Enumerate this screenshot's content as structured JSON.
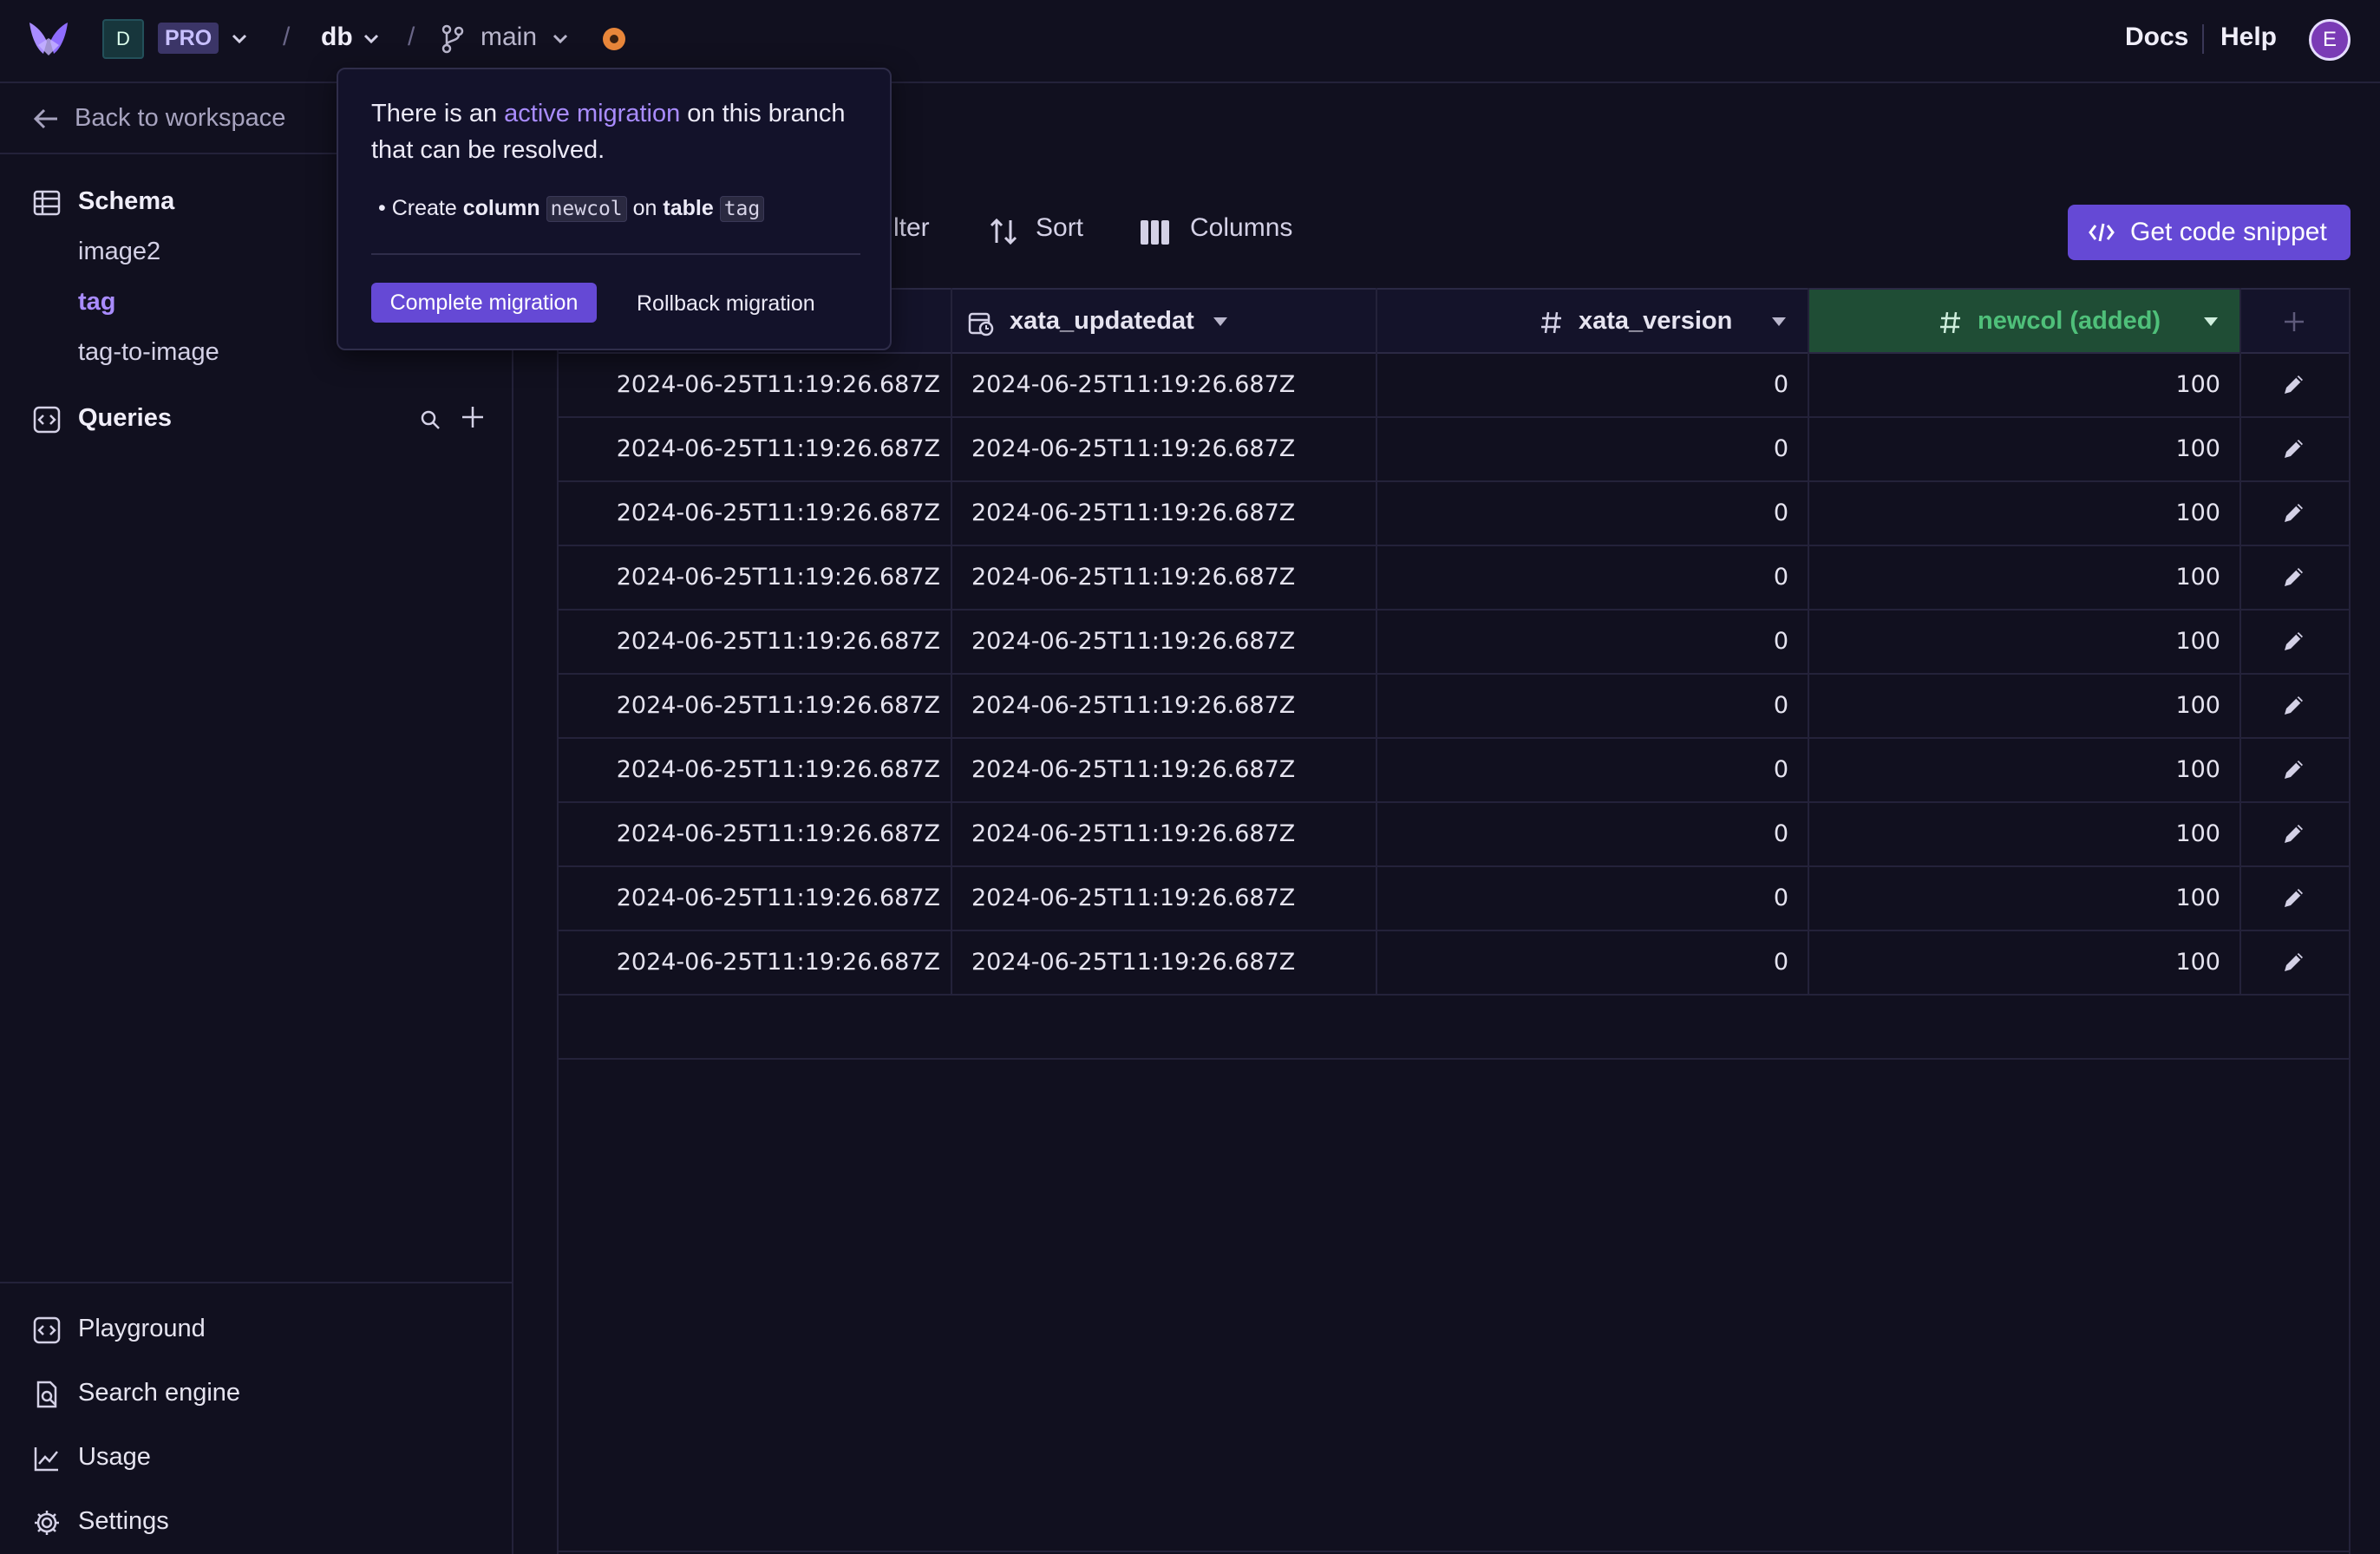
{
  "topbar": {
    "workspace_initial": "D",
    "plan_badge": "PRO",
    "separator": "/",
    "database": "db",
    "branch": "main",
    "docs": "Docs",
    "help": "Help",
    "user_initial": "E"
  },
  "sidebar": {
    "back": "Back to workspace",
    "schema_title": "Schema",
    "tables": [
      "image2",
      "tag",
      "tag-to-image"
    ],
    "active_table": "tag",
    "queries_title": "Queries",
    "bottom_nav": [
      "Playground",
      "Search engine",
      "Usage",
      "Settings"
    ]
  },
  "toolbar": {
    "filter": "lter",
    "sort": "Sort",
    "columns": "Columns",
    "snippet": "Get code snippet"
  },
  "table": {
    "columns": [
      {
        "name": "",
        "type": "datetime"
      },
      {
        "name": "xata_updatedat",
        "type": "datetime"
      },
      {
        "name": "xata_version",
        "type": "number"
      },
      {
        "name": "newcol (added)",
        "type": "number",
        "highlight": true
      }
    ],
    "rows": [
      [
        "2024-06-25T11:19:26.687Z",
        "2024-06-25T11:19:26.687Z",
        "0",
        "100"
      ],
      [
        "2024-06-25T11:19:26.687Z",
        "2024-06-25T11:19:26.687Z",
        "0",
        "100"
      ],
      [
        "2024-06-25T11:19:26.687Z",
        "2024-06-25T11:19:26.687Z",
        "0",
        "100"
      ],
      [
        "2024-06-25T11:19:26.687Z",
        "2024-06-25T11:19:26.687Z",
        "0",
        "100"
      ],
      [
        "2024-06-25T11:19:26.687Z",
        "2024-06-25T11:19:26.687Z",
        "0",
        "100"
      ],
      [
        "2024-06-25T11:19:26.687Z",
        "2024-06-25T11:19:26.687Z",
        "0",
        "100"
      ],
      [
        "2024-06-25T11:19:26.687Z",
        "2024-06-25T11:19:26.687Z",
        "0",
        "100"
      ],
      [
        "2024-06-25T11:19:26.687Z",
        "2024-06-25T11:19:26.687Z",
        "0",
        "100"
      ],
      [
        "2024-06-25T11:19:26.687Z",
        "2024-06-25T11:19:26.687Z",
        "0",
        "100"
      ],
      [
        "2024-06-25T11:19:26.687Z",
        "2024-06-25T11:19:26.687Z",
        "0",
        "100"
      ]
    ]
  },
  "popover": {
    "text_before": "There is an ",
    "link": "active migration",
    "text_after": " on this branch that can be resolved.",
    "bullet_create": "Create",
    "bullet_column_word": "column",
    "bullet_column_name": "newcol",
    "bullet_on": "on",
    "bullet_table_word": "table",
    "bullet_table_name": "tag",
    "complete": "Complete migration",
    "rollback": "Rollback migration"
  },
  "colors": {
    "accent": "#6549d5",
    "active_link": "#a98cff",
    "added_column_bg": "#1f4d35",
    "added_column_text": "#4fc07a",
    "branch_status": "#e8863a"
  }
}
